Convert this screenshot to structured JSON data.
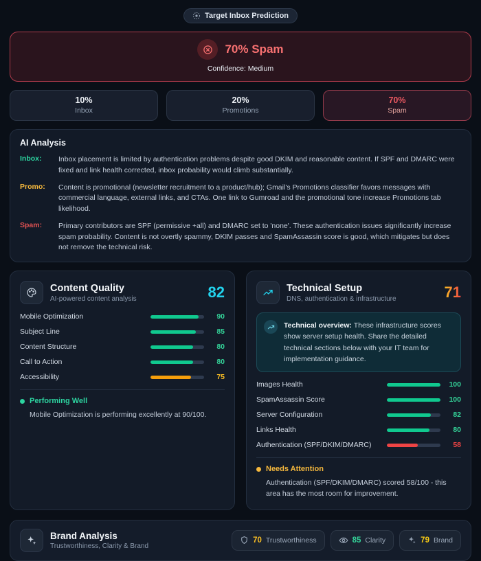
{
  "header_badge": {
    "label": "Target Inbox Prediction"
  },
  "banner": {
    "title": "70% Spam",
    "subtitle": "Confidence: Medium"
  },
  "placements": [
    {
      "pct": "10%",
      "label": "Inbox"
    },
    {
      "pct": "20%",
      "label": "Promotions"
    },
    {
      "pct": "70%",
      "label": "Spam"
    }
  ],
  "ai_analysis": {
    "title": "AI Analysis",
    "rows": [
      {
        "label": "Inbox:",
        "text": "Inbox placement is limited by authentication problems despite good DKIM and reasonable content. If SPF and DMARC were fixed and link health corrected, inbox probability would climb substantially."
      },
      {
        "label": "Promo:",
        "text": "Content is promotional (newsletter recruitment to a product/hub); Gmail's Promotions classifier favors messages with commercial language, external links, and CTAs. One link to Gumroad and the promotional tone increase Promotions tab likelihood."
      },
      {
        "label": "Spam:",
        "text": "Primary contributors are SPF (permissive +all) and DMARC set to 'none'. These authentication issues significantly increase spam probability. Content is not overtly spammy, DKIM passes and SpamAssassin score is good, which mitigates but does not remove the technical risk."
      }
    ]
  },
  "content_quality": {
    "title": "Content Quality",
    "subtitle": "AI-powered content analysis",
    "score": "82",
    "metrics": [
      {
        "label": "Mobile Optimization",
        "value": 90,
        "tone": "green"
      },
      {
        "label": "Subject Line",
        "value": 85,
        "tone": "green"
      },
      {
        "label": "Content Structure",
        "value": 80,
        "tone": "green"
      },
      {
        "label": "Call to Action",
        "value": 80,
        "tone": "green"
      },
      {
        "label": "Accessibility",
        "value": 75,
        "tone": "amber"
      }
    ],
    "note_title": "Performing Well",
    "note_text": "Mobile Optimization is performing excellently at 90/100."
  },
  "technical_setup": {
    "title": "Technical Setup",
    "subtitle": "DNS, authentication & infrastructure",
    "score": "71",
    "overview_bold": "Technical overview:",
    "overview_text": " These infrastructure scores show server setup health. Share the detailed technical sections below with your IT team for implementation guidance.",
    "metrics": [
      {
        "label": "Images Health",
        "value": 100,
        "tone": "green"
      },
      {
        "label": "SpamAssassin Score",
        "value": 100,
        "tone": "green"
      },
      {
        "label": "Server Configuration",
        "value": 82,
        "tone": "green"
      },
      {
        "label": "Links Health",
        "value": 80,
        "tone": "green"
      },
      {
        "label": "Authentication (SPF/DKIM/DMARC)",
        "value": 58,
        "tone": "red"
      }
    ],
    "note_title": "Needs Attention",
    "note_text": "Authentication (SPF/DKIM/DMARC) scored 58/100 - this area has the most room for improvement."
  },
  "brand_analysis": {
    "title": "Brand Analysis",
    "subtitle": "Trustworthiness, Clarity & Brand",
    "badges": [
      {
        "value": "70",
        "label": "Trustworthiness",
        "color": "#fbbf24"
      },
      {
        "value": "85",
        "label": "Clarity",
        "color": "#34d399"
      },
      {
        "value": "79",
        "label": "Brand",
        "color": "#facc15"
      }
    ]
  },
  "colors": {
    "accent_cyan": "#22d3ee",
    "good": "#10c98f",
    "warn": "#f59e0b",
    "bad": "#ef4444"
  }
}
